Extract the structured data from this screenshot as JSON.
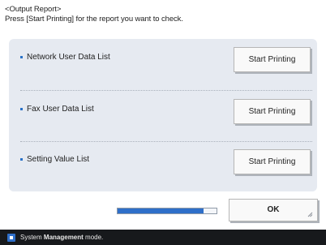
{
  "header": {
    "title": "<Output Report>",
    "instruction": "Press [Start Printing] for the report you want to check."
  },
  "reports": [
    {
      "label": "Network User Data List",
      "button": "Start Printing"
    },
    {
      "label": "Fax User Data List",
      "button": "Start Printing"
    },
    {
      "label": "Setting Value List",
      "button": "Start Printing"
    }
  ],
  "progress": {
    "fraction": 0.87
  },
  "ok_label": "OK",
  "status": {
    "prefix": "System ",
    "emphasis": "Management",
    "suffix": " mode."
  },
  "colors": {
    "accent": "#2f6fc9",
    "panel": "#e6eaf1",
    "statusbar": "#17191c"
  },
  "icons": {
    "status": "machine-status-icon",
    "ok_corner": "resize-corner-icon"
  }
}
